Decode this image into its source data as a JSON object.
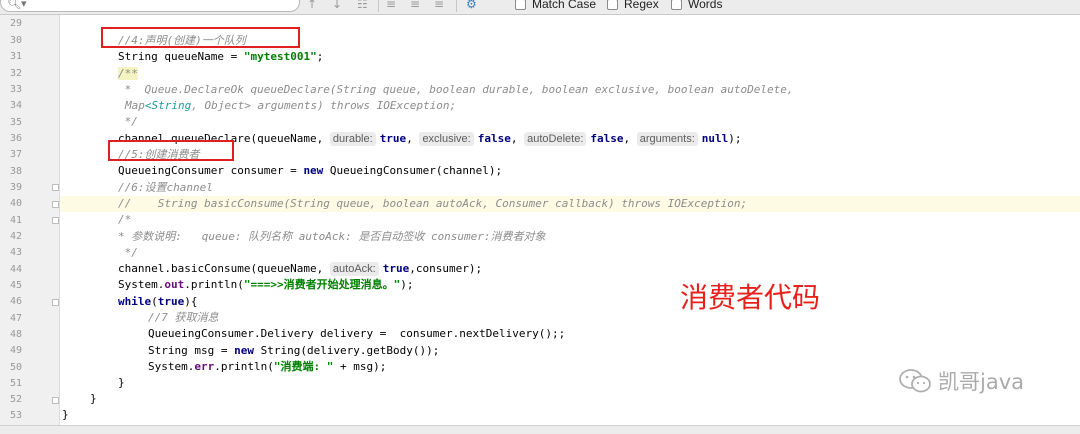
{
  "toolbar": {
    "match_case_label": "Match Case",
    "regex_label": "Regex",
    "words_label": "Words",
    "icons": [
      "search-icon",
      "up-arrow-icon",
      "down-arrow-icon",
      "find-all-icon",
      "filter-icon",
      "settings-gear-icon"
    ]
  },
  "editor": {
    "highlighted_line": "40",
    "lines": [
      {
        "num": "29",
        "text": ""
      },
      {
        "num": "30",
        "text": "//4:声明(创建)一个队列"
      },
      {
        "num": "31",
        "text": "String queueName = \"mytest001\";"
      },
      {
        "num": "32",
        "text": "/**"
      },
      {
        "num": "33",
        "text": " *  Queue.DeclareOk queueDeclare(String queue, boolean durable, boolean exclusive, boolean autoDelete,"
      },
      {
        "num": "34",
        "text": "Map<String, Object> arguments) throws IOException;"
      },
      {
        "num": "35",
        "text": " */"
      },
      {
        "num": "36",
        "text": "channel.queueDeclare(queueName, durable: true, exclusive: false, autoDelete: false, arguments: null);"
      },
      {
        "num": "37",
        "text": "//5:创建消费者"
      },
      {
        "num": "38",
        "text": "QueueingConsumer consumer = new QueueingConsumer(channel);"
      },
      {
        "num": "39",
        "text": "//6:设置channel"
      },
      {
        "num": "40",
        "text": "//    String basicConsume(String queue, boolean autoAck, Consumer callback) throws IOException;"
      },
      {
        "num": "41",
        "text": "/*"
      },
      {
        "num": "42",
        "text": "* 参数说明:   queue: 队列名称 autoAck: 是否自动签收 consumer:消费者对象"
      },
      {
        "num": "43",
        "text": " */"
      },
      {
        "num": "44",
        "text": "channel.basicConsume(queueName, autoAck: true,consumer);"
      },
      {
        "num": "45",
        "text": "System.out.println(\"===>>消费者开始处理消息。\");"
      },
      {
        "num": "46",
        "text": "while(true){"
      },
      {
        "num": "47",
        "text": "//7 获取消息"
      },
      {
        "num": "48",
        "text": "QueueingConsumer.Delivery delivery =  consumer.nextDelivery();;"
      },
      {
        "num": "49",
        "text": "String msg = new String(delivery.getBody());"
      },
      {
        "num": "50",
        "text": "System.err.println(\"消费端: \" + msg);"
      },
      {
        "num": "51",
        "text": "}"
      },
      {
        "num": "52",
        "text": "}"
      },
      {
        "num": "53",
        "text": "}"
      }
    ],
    "tokens": {
      "l31_a": "String queueName = ",
      "l31_str": "\"mytest001\"",
      "l31_b": ";",
      "l33_a": " *  ",
      "l33_b": "Queue.DeclareOk queueDeclare(String queue, boolean durable, boolean exclusive, boolean autoDelete,",
      "l34_a": "Map",
      "l34_gen": "<String",
      "l34_b": ", Object> arguments) throws IOException;",
      "l36_a": "channel.queueDeclare(queueName, ",
      "l36_h1": "durable:",
      "l36_v1": "true",
      "l36_c1": ", ",
      "l36_h2": "exclusive:",
      "l36_v2": "false",
      "l36_c2": ", ",
      "l36_h3": "autoDelete:",
      "l36_v3": "false",
      "l36_c3": ", ",
      "l36_h4": "arguments:",
      "l36_v4": "null",
      "l36_end": ");",
      "l38_a": "QueueingConsumer consumer = ",
      "l38_kw": "new",
      "l38_b": " QueueingConsumer(channel);",
      "l44_a": "channel.basicConsume(queueName, ",
      "l44_h": "autoAck:",
      "l44_v": "true",
      "l44_b": ",consumer);",
      "l45_a": "System.",
      "l45_fld": "out",
      "l45_b": ".println(",
      "l45_str": "\"===>>消费者开始处理消息。\"",
      "l45_c": ");",
      "l46_kw": "while",
      "l46_a": "(",
      "l46_kw2": "true",
      "l46_b": "){",
      "l49_a": "String msg = ",
      "l49_kw": "new",
      "l49_b": " String(delivery.getBody());",
      "l50_a": "System.",
      "l50_fld": "err",
      "l50_b": ".println(",
      "l50_str": "\"消费端: \"",
      "l50_c": " + msg);"
    }
  },
  "annotation_text": "消费者代码",
  "watermark_text": "凯哥java",
  "colors": {
    "annotation_red": "#e8201c",
    "keyword": "#000080",
    "string": "#008000",
    "comment": "#8c8c8c",
    "field": "#660e7a"
  }
}
